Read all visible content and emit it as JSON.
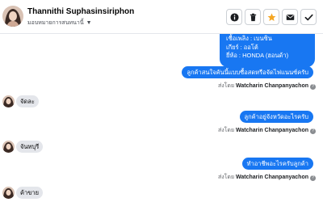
{
  "header": {
    "contact_name": "Thannithi Suphasinsiriphon",
    "subtitle": "มอบหมายการสนทนานี้",
    "actions": [
      {
        "icon": "info-circle-icon"
      },
      {
        "icon": "trash-icon"
      },
      {
        "icon": "star-icon",
        "color": "#f5a623"
      },
      {
        "icon": "envelope-icon"
      },
      {
        "icon": "checkmark-icon"
      }
    ]
  },
  "messages": {
    "info_lines": [
      "เชื้อเพลิง : เบนซิน",
      "เกียร์ : ออโต้",
      "ยี่ห้อ : HONDA (ฮอนด้า)"
    ],
    "sent_by_prefix": "ส่งโดย",
    "sender": "Watcharin Chanpanyachon",
    "help_glyph": "?",
    "outgoing": [
      "ลูกค้าสนใจคันนี้แบบซื้อสดหรือจัดไฟแนนซ์ครับ",
      "ลูกค้าอยู่จังหวัดอะไรครับ",
      "ทำอาชีพอะไรครับลูกค้า"
    ],
    "incoming": [
      "จัดละ",
      "จันทบุรี",
      "ค้าขาย"
    ]
  },
  "colors": {
    "accent": "#1877f2",
    "incoming_bubble": "#e4e6eb",
    "star": "#f5a623"
  }
}
